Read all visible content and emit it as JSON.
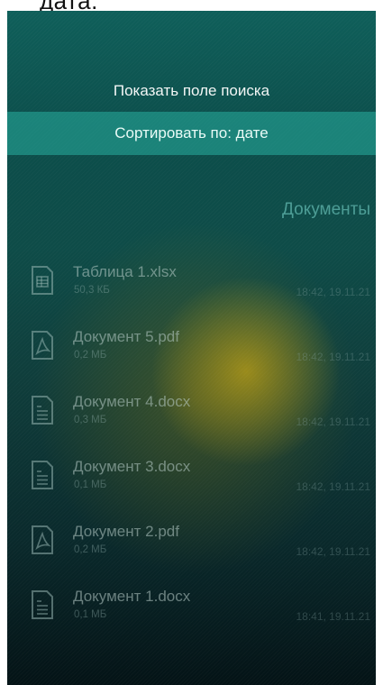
{
  "top_caption": "дата.",
  "menu": {
    "show_search": "Показать поле поиска",
    "sort_by": "Сортировать по: дате"
  },
  "section_title": "Документы",
  "files": [
    {
      "name": "Таблица 1.xlsx",
      "size": "50,3 КБ",
      "date": "18:42, 19.11.21",
      "icon": "spreadsheet-icon"
    },
    {
      "name": "Документ 5.pdf",
      "size": "0,2 МБ",
      "date": "18:42, 19.11.21",
      "icon": "pdf-icon"
    },
    {
      "name": "Документ 4.docx",
      "size": "0,3 МБ",
      "date": "18:42, 19.11.21",
      "icon": "text-document-icon"
    },
    {
      "name": "Документ 3.docx",
      "size": "0,1 МБ",
      "date": "18:42, 19.11.21",
      "icon": "text-document-icon"
    },
    {
      "name": "Документ 2.pdf",
      "size": "0,2 МБ",
      "date": "18:42, 19.11.21",
      "icon": "pdf-icon"
    },
    {
      "name": "Документ 1.docx",
      "size": "0,1 МБ",
      "date": "18:41, 19.11.21",
      "icon": "text-document-icon"
    }
  ],
  "colors": {
    "accent_teal": "#2aaf9f",
    "background_top": "#0f5f5a",
    "background_bottom": "#041316",
    "glow_yellow": "#bea014"
  }
}
